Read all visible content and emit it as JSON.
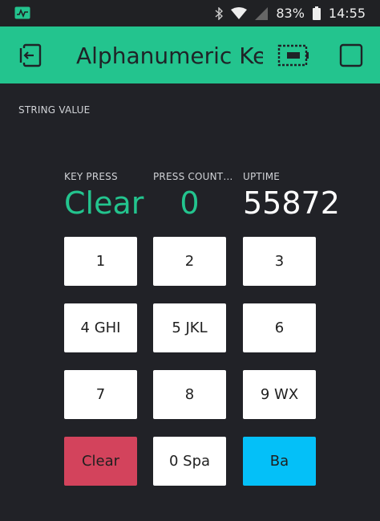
{
  "status_bar": {
    "battery_percent": "83%",
    "time": "14:55",
    "icons": [
      "activity-icon",
      "bluetooth-icon",
      "wifi-icon",
      "signal-icon",
      "battery-icon"
    ]
  },
  "app_bar": {
    "title": "Alphanumeric Keypad",
    "icons": [
      "exit-icon",
      "device-icon",
      "stop-icon"
    ]
  },
  "string_value": {
    "label": "STRING VALUE"
  },
  "stats": {
    "key_press_label": "KEY PRESS",
    "key_press_value": "Clear",
    "press_count_label": "PRESS COUNT…",
    "press_count_value": "0",
    "uptime_label": "UPTIME",
    "uptime_value": "55872"
  },
  "keypad": {
    "keys": [
      "1",
      "2",
      "3",
      "4 GHI",
      "5 JKL",
      "6",
      "7",
      "8",
      "9 WX",
      "Clear",
      "0 Spa",
      "Ba"
    ]
  },
  "colors": {
    "accent_green": "#23c48e",
    "clear_red": "#d3435c",
    "back_blue": "#04c0f8",
    "background": "#212227"
  }
}
